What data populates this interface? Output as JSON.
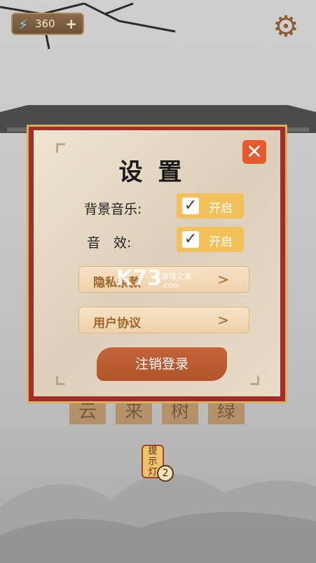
{
  "hud": {
    "currency_value": "360",
    "currency_icon": "lightning-icon",
    "add_icon": "plus-icon",
    "settings_icon": "gear-icon"
  },
  "background": {
    "tiles": [
      "云",
      "来",
      "树",
      "绿"
    ],
    "hint": {
      "label": "提示灯",
      "count": "2"
    }
  },
  "dialog": {
    "title": "设置",
    "close_icon": "close-icon",
    "settings": [
      {
        "label": "背景音乐:",
        "toggle_label": "开启",
        "checked": true
      },
      {
        "label": "音　效:",
        "toggle_label": "开启",
        "checked": true
      }
    ],
    "menu": [
      {
        "label": "隐私条款",
        "arrow": ">"
      },
      {
        "label": "用户协议",
        "arrow": ">"
      }
    ],
    "logout_label": "注销登录"
  },
  "watermark": {
    "brand": "K73",
    "sub": [
      "游戏之家",
      ".com"
    ]
  },
  "colors": {
    "accent": "#f3c15a",
    "frame": "#a32d2a",
    "gold": "#d7b25a",
    "button": "#b2552c"
  }
}
